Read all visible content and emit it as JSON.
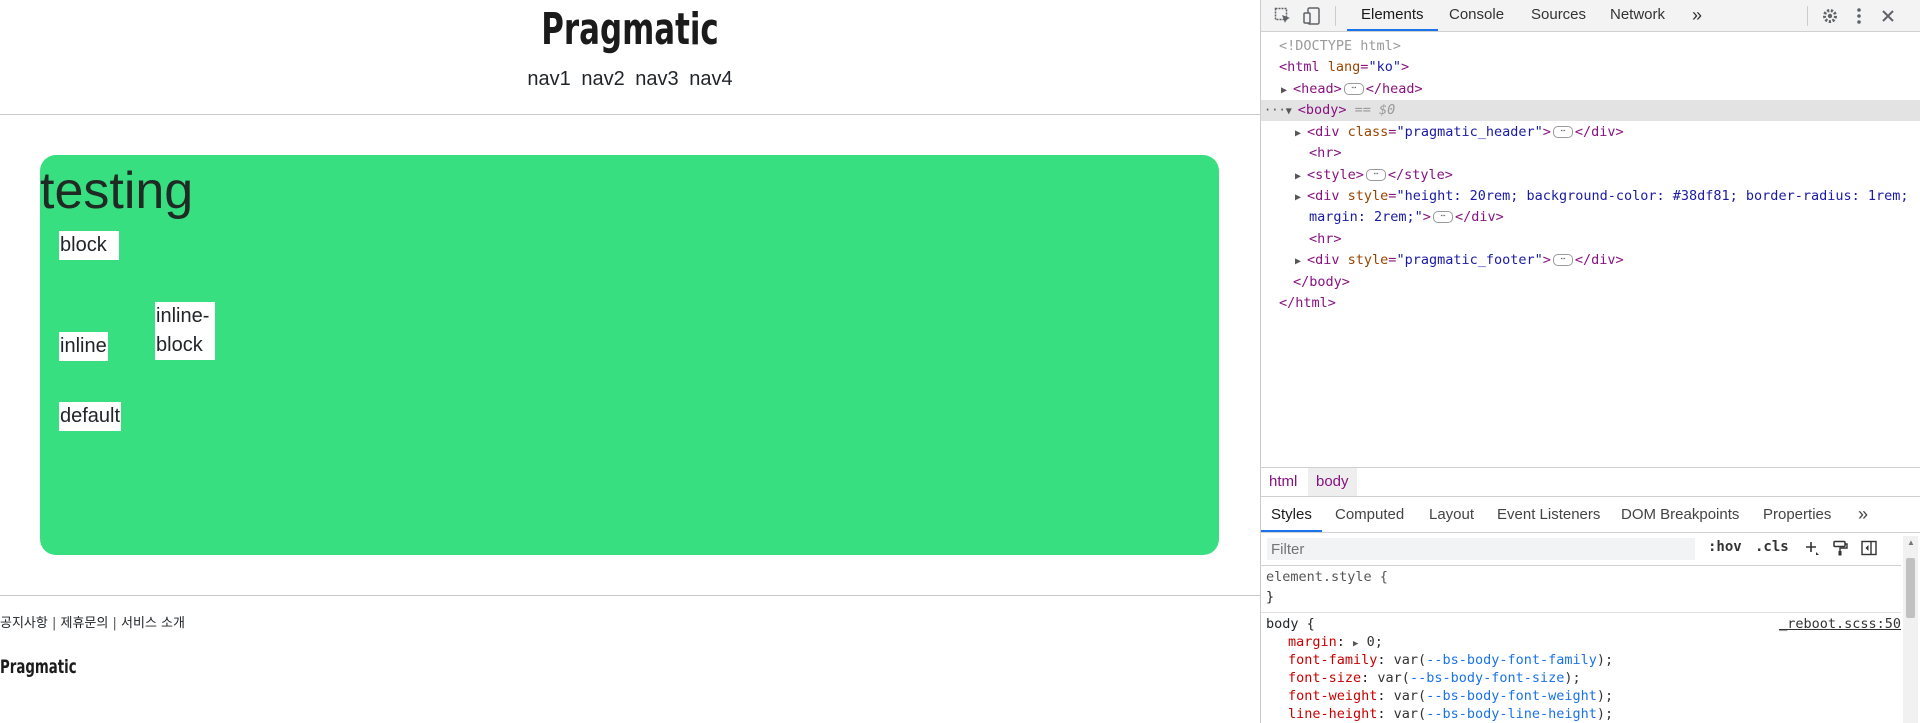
{
  "page": {
    "logo": "Pragmatic",
    "nav": [
      "nav1",
      "nav2",
      "nav3",
      "nav4"
    ],
    "card": {
      "title": "testing",
      "color": "#38df81",
      "boxes": {
        "block": "block",
        "inline": "inline",
        "inline_block_line1": "inline-",
        "inline_block_line2": "block",
        "default": "default"
      }
    },
    "footer": {
      "links": [
        "공지사항",
        "제휴문의",
        "서비스 소개"
      ],
      "separator": "|",
      "logo": "Pragmatic"
    }
  },
  "devtools": {
    "tabs": [
      "Elements",
      "Console",
      "Sources",
      "Network"
    ],
    "active_tab": "Elements",
    "more_tabs": "»",
    "icons": [
      "inspect-element-icon",
      "device-toolbar-icon",
      "settings-icon",
      "more-options-icon",
      "close-icon"
    ],
    "dom": {
      "doctype": "<!DOCTYPE html>",
      "html_open_tag": "<html",
      "html_lang_attr": "lang",
      "html_lang_val": "\"ko\"",
      "head_open": "<head>",
      "head_close": "</head>",
      "body_open": "<body>",
      "body_marker": "== $0",
      "div_header_open": "<div",
      "class_attr": "class",
      "header_class_val": "\"pragmatic_header\"",
      "div_close": "</div>",
      "hr": "<hr>",
      "style_open": "<style>",
      "style_close": "</style>",
      "style_attr": "style",
      "card_style_val_1": "\"height: 20rem; background-color: #38df81; border-radius: 1rem;",
      "card_style_val_2": "margin: 2rem;\"",
      "footer_style_val": "\"pragmatic_footer\"",
      "body_close": "</body>",
      "html_close": "</html>",
      "ellipsis": "⋯"
    },
    "breadcrumbs": [
      "html",
      "body"
    ],
    "subtabs": [
      "Styles",
      "Computed",
      "Layout",
      "Event Listeners",
      "DOM Breakpoints",
      "Properties"
    ],
    "active_subtab": "Styles",
    "filter": {
      "placeholder": "Filter",
      "hov": ":hov",
      "cls": ".cls"
    },
    "styles": {
      "element_style": "element.style {",
      "close_brace": "}",
      "body_selector": "body {",
      "source": "_reboot.scss:50",
      "rules": [
        {
          "prop": "margin",
          "value": "0;"
        },
        {
          "prop": "font-family",
          "value": "--bs-body-font-family"
        },
        {
          "prop": "font-size",
          "value": "--bs-body-font-size"
        },
        {
          "prop": "font-weight",
          "value": "--bs-body-font-weight"
        },
        {
          "prop": "line-height",
          "value": "--bs-body-line-height"
        }
      ]
    }
  }
}
